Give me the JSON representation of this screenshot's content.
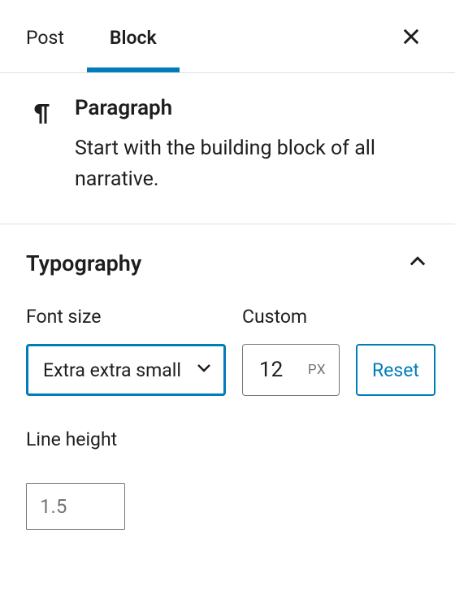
{
  "tabs": {
    "post": "Post",
    "block": "Block"
  },
  "block": {
    "title": "Paragraph",
    "description": "Start with the building block of all narrative."
  },
  "typography": {
    "title": "Typography",
    "fontSize": {
      "label": "Font size",
      "value": "Extra extra small"
    },
    "custom": {
      "label": "Custom",
      "value": "12",
      "unit": "PX"
    },
    "reset": "Reset",
    "lineHeight": {
      "label": "Line height",
      "placeholder": "1.5"
    }
  }
}
